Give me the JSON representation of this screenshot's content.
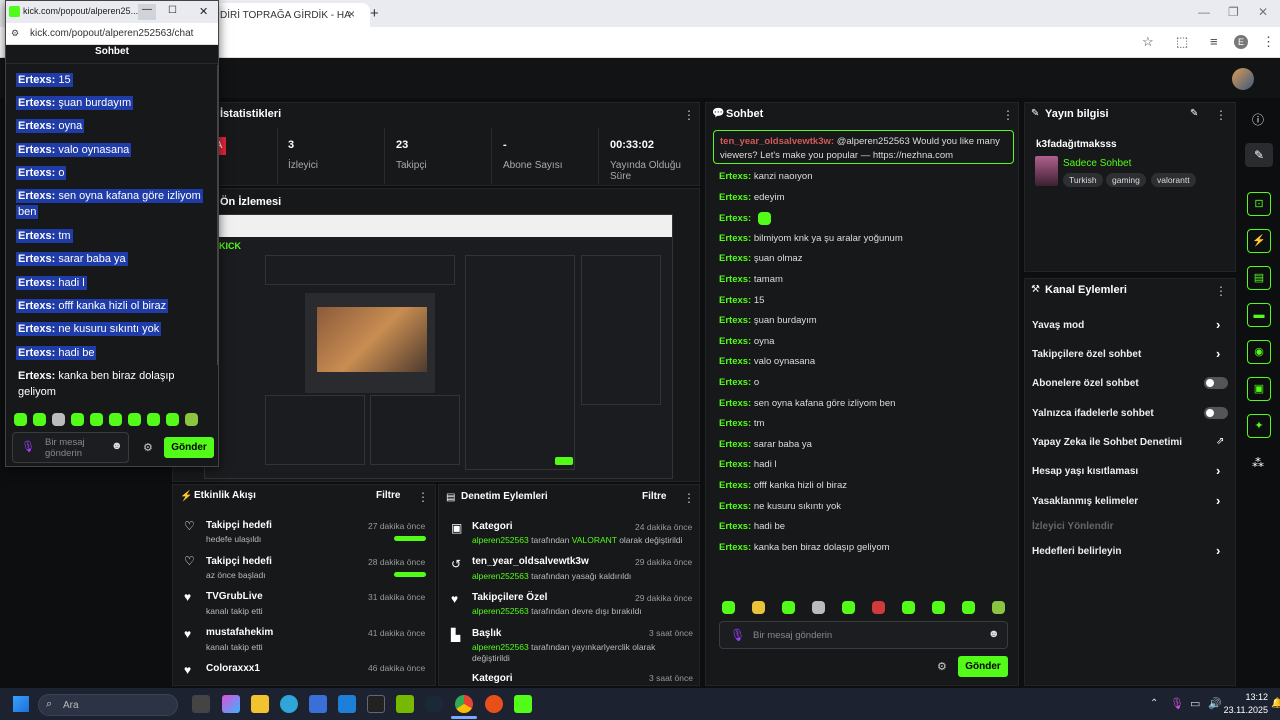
{
  "browser": {
    "active_tab_title": "DİRİ TOPRAĞA GİRDİK - HA",
    "tab_close": "×",
    "new_tab": "+"
  },
  "popout": {
    "tab_title": "kick.com/popout/alperen25...",
    "url": "kick.com/popout/alperen252563/chat",
    "header": "Sohbet",
    "messages": [
      {
        "user": "Ertexs:",
        "text": "15"
      },
      {
        "user": "Ertexs:",
        "text": "şuan burdayım"
      },
      {
        "user": "Ertexs:",
        "text": "oyna"
      },
      {
        "user": "Ertexs:",
        "text": "valo oynasana"
      },
      {
        "user": "Ertexs:",
        "text": "o"
      },
      {
        "user": "Ertexs:",
        "text": "sen oyna kafana göre izliyom"
      },
      {
        "user": "",
        "text": "ben"
      },
      {
        "user": "Ertexs:",
        "text": "tm"
      },
      {
        "user": "Ertexs:",
        "text": "sarar baba ya"
      },
      {
        "user": "Ertexs:",
        "text": "hadi l"
      },
      {
        "user": "Ertexs:",
        "text": "offf kanka hizli ol biraz"
      },
      {
        "user": "Ertexs:",
        "text": "ne kusuru sıkıntı yok"
      },
      {
        "user": "Ertexs:",
        "text": "hadi be"
      },
      {
        "user": "Ertexs:",
        "text": "kanka ben biraz dolaşıp"
      },
      {
        "user": "",
        "text": "geliyom"
      }
    ],
    "input_placeholder": "Bir mesaj gönderin",
    "send_label": "Gönder"
  },
  "stats": {
    "title": "İstatistikleri",
    "items": [
      {
        "value": "3",
        "label": "İzleyici"
      },
      {
        "value": "23",
        "label": "Takipçi"
      },
      {
        "value": "-",
        "label": "Abone Sayısı"
      },
      {
        "value": "00:33:02",
        "label": "Yayında Olduğu Süre"
      }
    ],
    "live_badge": "A"
  },
  "preview": {
    "title": "Ön İzlemesi"
  },
  "chat": {
    "title": "Sohbet",
    "highlight_user": "ten_year_oldsalvewtk3w:",
    "highlight_text": "@alperen252563 Would you like many viewers? Let's make you popular — https://nezhna.com",
    "messages": [
      {
        "user": "Ertexs:",
        "text": "kanzi naoıyon"
      },
      {
        "user": "Ertexs:",
        "text": "edeyim"
      },
      {
        "user": "Ertexs:",
        "text": ""
      },
      {
        "user": "Ertexs:",
        "text": "bilmiyom knk ya şu aralar yoğunum"
      },
      {
        "user": "Ertexs:",
        "text": "şuan olmaz"
      },
      {
        "user": "Ertexs:",
        "text": "tamam"
      },
      {
        "user": "Ertexs:",
        "text": "15"
      },
      {
        "user": "Ertexs:",
        "text": "şuan burdayım"
      },
      {
        "user": "Ertexs:",
        "text": "oyna"
      },
      {
        "user": "Ertexs:",
        "text": "valo oynasana"
      },
      {
        "user": "Ertexs:",
        "text": "o"
      },
      {
        "user": "Ertexs:",
        "text": "sen oyna kafana göre izliyom ben"
      },
      {
        "user": "Ertexs:",
        "text": "tm"
      },
      {
        "user": "Ertexs:",
        "text": "sarar baba ya"
      },
      {
        "user": "Ertexs:",
        "text": "hadi l"
      },
      {
        "user": "Ertexs:",
        "text": "offf kanka hizli ol biraz"
      },
      {
        "user": "Ertexs:",
        "text": "ne kusuru sıkıntı yok"
      },
      {
        "user": "Ertexs:",
        "text": "hadi be"
      },
      {
        "user": "Ertexs:",
        "text": "kanka ben biraz dolaşıp geliyom"
      }
    ],
    "input_placeholder": "Bir mesaj gönderin",
    "send_label": "Gönder"
  },
  "stream_info": {
    "title": "Yayın bilgisi",
    "stream_title": "k3fadağıtmaksss",
    "chat_mode": "Sadece Sohbet",
    "tags": [
      "Turkish",
      "gaming",
      "valorantt"
    ]
  },
  "channel_actions": {
    "title": "Kanal Eylemleri",
    "items": [
      {
        "label": "Yavaş mod"
      },
      {
        "label": "Takipçilere özel sohbet"
      },
      {
        "label": "Abonelere özel sohbet"
      },
      {
        "label": "Yalnızca ifadelerle sohbet"
      },
      {
        "label": "Yapay Zeka ile Sohbet Denetimi"
      },
      {
        "label": "Hesap yaşı kısıtlaması"
      },
      {
        "label": "Yasaklanmış kelimeler"
      },
      {
        "label": "İzleyici Yönlendir"
      },
      {
        "label": "Hedefleri belirleyin"
      }
    ]
  },
  "activity": {
    "title": "Etkinlik Akışı",
    "filter": "Filtre",
    "items": [
      {
        "title": "Takipçi hedefi",
        "sub": "hedefe ulaşıldı",
        "time": "27 dakika önce",
        "progress": 1.0
      },
      {
        "title": "Takipçi hedefi",
        "sub": "az önce başladı",
        "time": "28 dakika önce",
        "progress": 1.0
      },
      {
        "title": "TVGrubLive",
        "sub": "kanalı takip etti",
        "time": "31 dakika önce"
      },
      {
        "title": "mustafahekim",
        "sub": "kanalı takip etti",
        "time": "41 dakika önce"
      },
      {
        "title": "Coloraxxx1",
        "sub": "",
        "time": "46 dakika önce"
      }
    ]
  },
  "moderation": {
    "title": "Denetim Eylemleri",
    "filter": "Filtre",
    "items": [
      {
        "title": "Kategori",
        "actor": "alperen252563",
        "text": "tarafından",
        "highlight": "VALORANT",
        "text2": "olarak değiştirildi",
        "time": "24 dakika önce"
      },
      {
        "title": "ten_year_oldsalvewtk3w",
        "actor": "alperen252563",
        "text": "tarafından yasağı kaldırıldı",
        "time": "29 dakika önce"
      },
      {
        "title": "Takipçilere Özel",
        "actor": "alperen252563",
        "text": "tarafından devre dışı bırakıldı",
        "time": "29 dakika önce"
      },
      {
        "title": "Başlık",
        "actor": "alperen252563",
        "text": "tarafından yayınkarlyerclik olarak",
        "text2": "değiştirildi",
        "time": "3 saat önce"
      },
      {
        "title": "Kategori",
        "time": "3 saat önce"
      }
    ]
  },
  "taskbar": {
    "search_placeholder": "Ara",
    "time": "13:12",
    "date": "23.11.2025"
  },
  "colors": {
    "accent": "#53fc18",
    "selection": "#1f3ca8"
  }
}
